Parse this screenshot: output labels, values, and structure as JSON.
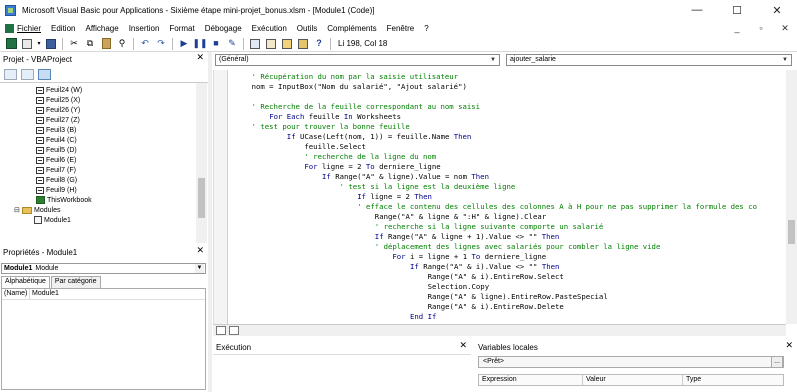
{
  "window": {
    "title": "Microsoft Visual Basic pour Applications - Sixième étape mini-projet_bonus.xlsm - [Module1 (Code)]",
    "minimize": "—",
    "maximize": "☐",
    "close": "✕"
  },
  "menu": {
    "items": [
      "Fichier",
      "Edition",
      "Affichage",
      "Insertion",
      "Format",
      "Débogage",
      "Exécution",
      "Outils",
      "Compléments",
      "Fenêtre",
      "?"
    ],
    "right_controls": [
      "_",
      "▫",
      "✕"
    ]
  },
  "toolbar": {
    "status": "Li 198, Col 18"
  },
  "project": {
    "title": "Projet - VBAProject",
    "close": "✕",
    "tree": [
      {
        "label": "Feuil24 (W)",
        "type": "sheet"
      },
      {
        "label": "Feuil25 (X)",
        "type": "sheet"
      },
      {
        "label": "Feuil26 (Y)",
        "type": "sheet"
      },
      {
        "label": "Feuil27 (Z)",
        "type": "sheet"
      },
      {
        "label": "Feuil3 (B)",
        "type": "sheet"
      },
      {
        "label": "Feuil4 (C)",
        "type": "sheet"
      },
      {
        "label": "Feuil5 (D)",
        "type": "sheet"
      },
      {
        "label": "Feuil6 (E)",
        "type": "sheet"
      },
      {
        "label": "Feuil7 (F)",
        "type": "sheet"
      },
      {
        "label": "Feuil8 (G)",
        "type": "sheet"
      },
      {
        "label": "Feuil9 (H)",
        "type": "sheet"
      },
      {
        "label": "ThisWorkbook",
        "type": "workbook"
      },
      {
        "label": "Modules",
        "type": "folder"
      },
      {
        "label": "Module1",
        "type": "module"
      }
    ]
  },
  "properties": {
    "title": "Propriétés - Module1",
    "close": "✕",
    "object_name": "Module1",
    "object_type": "Module",
    "tabs": [
      "Alphabétique",
      "Par catégorie"
    ],
    "rows": [
      {
        "name": "(Name)",
        "value": "Module1"
      }
    ]
  },
  "code": {
    "object_combo": "(Général)",
    "proc_combo": "ajouter_salarie",
    "lines": [
      {
        "indent": 4,
        "kind": "comment",
        "text": "' Récupération du nom par la saisie utilisateur"
      },
      {
        "indent": 4,
        "kind": "code",
        "text": "nom = InputBox(\"Nom du salarié\", \"Ajout salarié\")"
      },
      {
        "indent": 4,
        "kind": "blank",
        "text": ""
      },
      {
        "indent": 4,
        "kind": "comment",
        "text": "' Recherche de la feuille correspondant au nom saisi"
      },
      {
        "indent": 8,
        "kind": "code",
        "text": "For Each feuille In Worksheets"
      },
      {
        "indent": 4,
        "kind": "comment",
        "text": "' test pour trouver la bonne feuille"
      },
      {
        "indent": 12,
        "kind": "code",
        "text": "If UCase(Left(nom, 1)) = feuille.Name Then"
      },
      {
        "indent": 16,
        "kind": "code",
        "text": "feuille.Select"
      },
      {
        "indent": 16,
        "kind": "comment",
        "text": "' recherche de la ligne du nom"
      },
      {
        "indent": 16,
        "kind": "code",
        "text": "For ligne = 2 To derniere_ligne"
      },
      {
        "indent": 20,
        "kind": "code",
        "text": "If Range(\"A\" & ligne).Value = nom Then"
      },
      {
        "indent": 24,
        "kind": "comment",
        "text": "' test si la ligne est la deuxième ligne"
      },
      {
        "indent": 28,
        "kind": "code",
        "text": "If ligne = 2 Then"
      },
      {
        "indent": 28,
        "kind": "comment",
        "text": "' efface le contenu des cellules des colonnes A à H pour ne pas supprimer la formule des co"
      },
      {
        "indent": 32,
        "kind": "code",
        "text": "Range(\"A\" & ligne & \":H\" & ligne).Clear"
      },
      {
        "indent": 32,
        "kind": "comment",
        "text": "' recherche si la ligne suivante comporte un salarié"
      },
      {
        "indent": 32,
        "kind": "code",
        "text": "If Range(\"A\" & ligne + 1).Value <> \"\" Then"
      },
      {
        "indent": 32,
        "kind": "comment",
        "text": "' déplacement des lignes avec salariés pour combler la ligne vide"
      },
      {
        "indent": 36,
        "kind": "code",
        "text": "For i = ligne + 1 To derniere_ligne"
      },
      {
        "indent": 40,
        "kind": "code",
        "text": "If Range(\"A\" & i).Value <> \"\" Then"
      },
      {
        "indent": 44,
        "kind": "code",
        "text": "Range(\"A\" & i).EntireRow.Select"
      },
      {
        "indent": 44,
        "kind": "code",
        "text": "Selection.Copy"
      },
      {
        "indent": 44,
        "kind": "code",
        "text": "Range(\"A\" & ligne).EntireRow.PasteSpecial"
      },
      {
        "indent": 44,
        "kind": "code",
        "text": "Range(\"A\" & i).EntireRow.Delete"
      },
      {
        "indent": 40,
        "kind": "code",
        "text": "End If"
      }
    ]
  },
  "immediate": {
    "title": "Exécution",
    "close": "✕"
  },
  "locals": {
    "title": "Variables locales",
    "close": "✕",
    "ready": "<Prêt>",
    "dots": "...",
    "columns": [
      "Expression",
      "Valeur",
      "Type"
    ]
  },
  "colors": {
    "comment": "#008000",
    "keyword": "#00008b"
  }
}
